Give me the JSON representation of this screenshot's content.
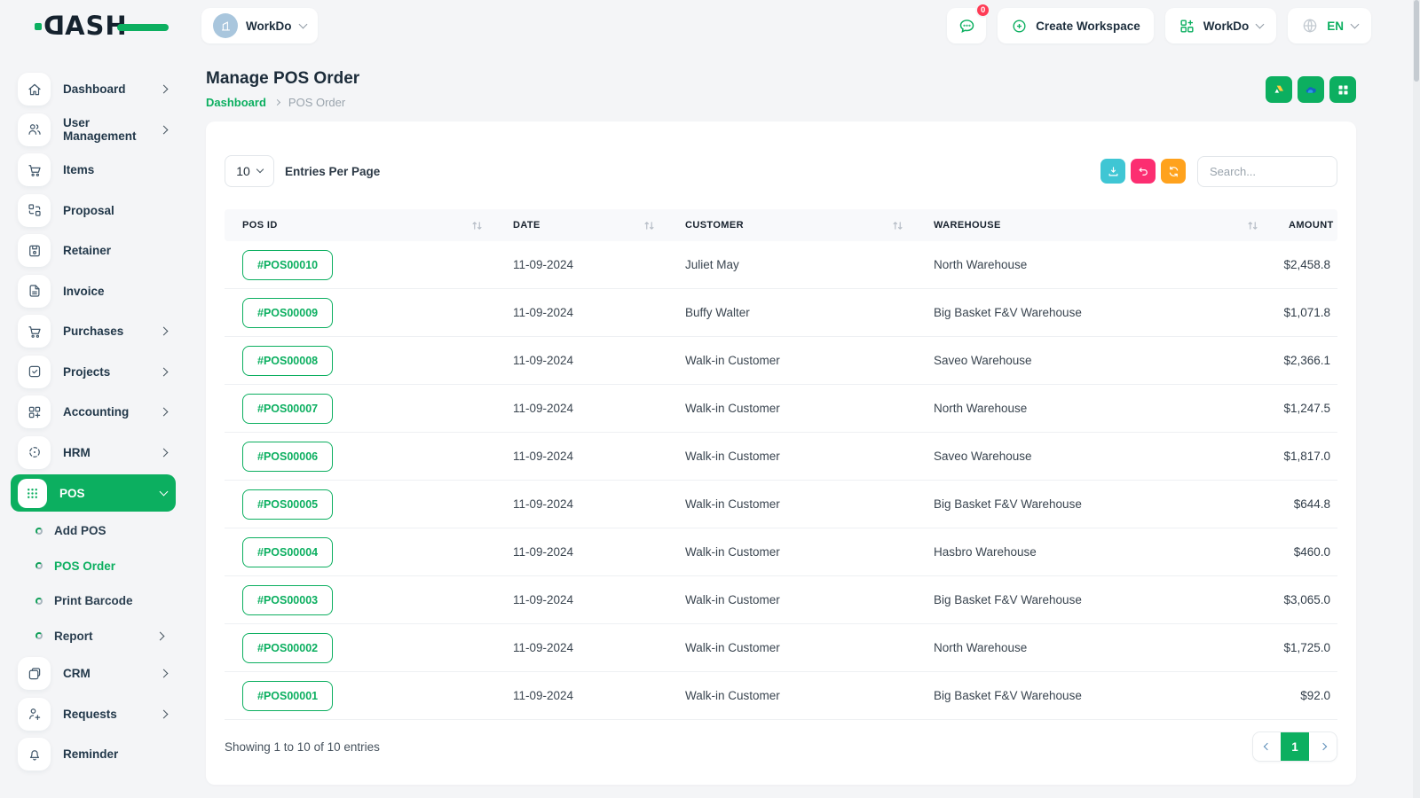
{
  "brand": {
    "logo_d": "D",
    "logo_rest": "ASH"
  },
  "topbar": {
    "workspace_chip_label": "WorkDo",
    "messages_badge": "0",
    "create_workspace_label": "Create Workspace",
    "workspace_dropdown_label": "WorkDo",
    "language": "EN"
  },
  "sidebar": {
    "items": [
      {
        "label": "Dashboard",
        "icon": "home-icon"
      },
      {
        "label": "User Management",
        "icon": "users-icon"
      },
      {
        "label": "Items",
        "icon": "cart-icon"
      },
      {
        "label": "Proposal",
        "icon": "proposal-icon"
      },
      {
        "label": "Retainer",
        "icon": "retainer-icon"
      },
      {
        "label": "Invoice",
        "icon": "invoice-icon"
      },
      {
        "label": "Purchases",
        "icon": "purchases-cart-icon"
      },
      {
        "label": "Projects",
        "icon": "projects-check-icon"
      },
      {
        "label": "Accounting",
        "icon": "accounting-grid-icon"
      },
      {
        "label": "HRM",
        "icon": "hrm-icon"
      },
      {
        "label": "POS",
        "icon": "pos-grid-icon",
        "active": true
      }
    ],
    "pos_subitems": [
      {
        "label": "Add POS"
      },
      {
        "label": "POS Order",
        "active": true
      },
      {
        "label": "Print Barcode"
      },
      {
        "label": "Report"
      }
    ],
    "items_bottom": [
      {
        "label": "CRM",
        "icon": "crm-icon"
      },
      {
        "label": "Requests",
        "icon": "user-plus-icon"
      },
      {
        "label": "Reminder",
        "icon": "bell-icon"
      }
    ]
  },
  "page": {
    "title": "Manage POS Order",
    "breadcrumb_link": "Dashboard",
    "breadcrumb_current": "POS Order"
  },
  "toolbar": {
    "entries_per_page_value": "10",
    "entries_per_page_label": "Entries Per Page",
    "search_placeholder": "Search..."
  },
  "table": {
    "columns": {
      "c0": "POS ID",
      "c1": "DATE",
      "c2": "CUSTOMER",
      "c3": "WAREHOUSE",
      "c4": "AMOUNT"
    },
    "rows": [
      {
        "pos_id": "#POS00010",
        "date": "11-09-2024",
        "customer": "Juliet May",
        "warehouse": "North Warehouse",
        "amount": "$2,458.8"
      },
      {
        "pos_id": "#POS00009",
        "date": "11-09-2024",
        "customer": "Buffy Walter",
        "warehouse": "Big Basket F&V Warehouse",
        "amount": "$1,071.8"
      },
      {
        "pos_id": "#POS00008",
        "date": "11-09-2024",
        "customer": "Walk-in Customer",
        "warehouse": "Saveo Warehouse",
        "amount": "$2,366.1"
      },
      {
        "pos_id": "#POS00007",
        "date": "11-09-2024",
        "customer": "Walk-in Customer",
        "warehouse": "North Warehouse",
        "amount": "$1,247.5"
      },
      {
        "pos_id": "#POS00006",
        "date": "11-09-2024",
        "customer": "Walk-in Customer",
        "warehouse": "Saveo Warehouse",
        "amount": "$1,817.0"
      },
      {
        "pos_id": "#POS00005",
        "date": "11-09-2024",
        "customer": "Walk-in Customer",
        "warehouse": "Big Basket F&V Warehouse",
        "amount": "$644.8"
      },
      {
        "pos_id": "#POS00004",
        "date": "11-09-2024",
        "customer": "Walk-in Customer",
        "warehouse": "Hasbro Warehouse",
        "amount": "$460.0"
      },
      {
        "pos_id": "#POS00003",
        "date": "11-09-2024",
        "customer": "Walk-in Customer",
        "warehouse": "Big Basket F&V Warehouse",
        "amount": "$3,065.0"
      },
      {
        "pos_id": "#POS00002",
        "date": "11-09-2024",
        "customer": "Walk-in Customer",
        "warehouse": "North Warehouse",
        "amount": "$1,725.0"
      },
      {
        "pos_id": "#POS00001",
        "date": "11-09-2024",
        "customer": "Walk-in Customer",
        "warehouse": "Big Basket F&V Warehouse",
        "amount": "$92.0"
      }
    ]
  },
  "footer": {
    "showing_text": "Showing 1 to 10 of 10 entries",
    "current_page": "1"
  },
  "colors": {
    "primary_green": "#0caf60",
    "cyan_button": "#3fc6d4",
    "pink_button": "#fc2e71",
    "orange_button": "#ffa21d",
    "badge_red": "#ff3b55",
    "heading": "#1c2c3a"
  }
}
